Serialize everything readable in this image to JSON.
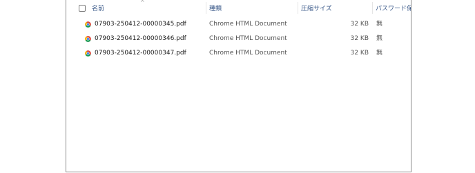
{
  "columns": {
    "name": "名前",
    "type": "種類",
    "size": "圧縮サイズ",
    "password": "パスワード保護"
  },
  "files": [
    {
      "name": "07903-250412-00000345.pdf",
      "type": "Chrome HTML Document",
      "size": "32 KB",
      "password": "無",
      "icon": "chrome-icon"
    },
    {
      "name": "07903-250412-00000346.pdf",
      "type": "Chrome HTML Document",
      "size": "32 KB",
      "password": "無",
      "icon": "chrome-icon"
    },
    {
      "name": "07903-250412-00000347.pdf",
      "type": "Chrome HTML Document",
      "size": "32 KB",
      "password": "無",
      "icon": "chrome-icon"
    }
  ],
  "sort": {
    "column": "name",
    "direction": "ascending"
  }
}
